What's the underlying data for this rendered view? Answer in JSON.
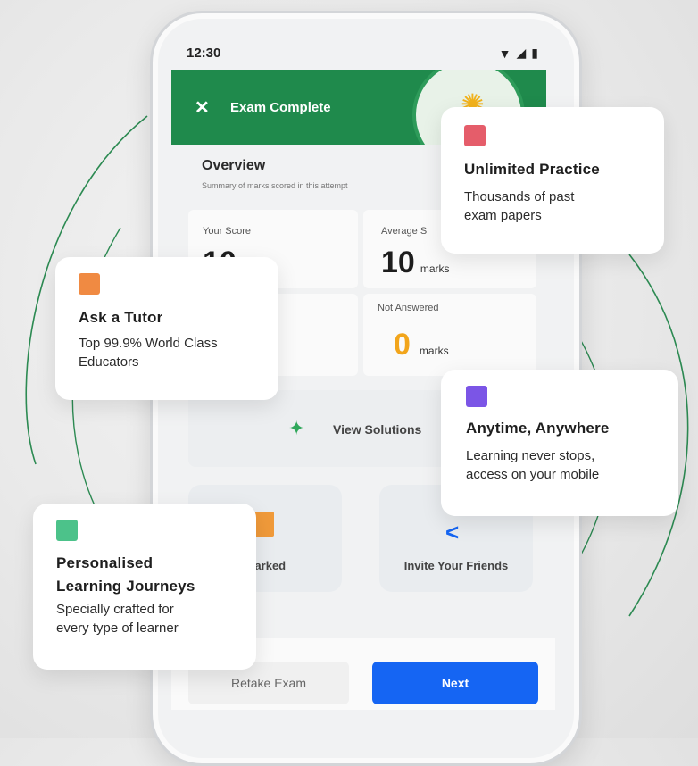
{
  "status_bar": {
    "time": "12:30",
    "signal_icon": "wifi-icon",
    "cell_icon": "cell-signal-icon",
    "battery_icon": "battery-icon"
  },
  "appbar": {
    "title": "Exam Complete",
    "close_icon": "close-icon",
    "badge_icon": "sun-icon",
    "color": "#1f8a4c"
  },
  "overview": {
    "title": "Overview",
    "subtitle": "Summary of marks scored in this attempt",
    "your_score": {
      "label": "Your Score",
      "value": "10",
      "unit": "marks"
    },
    "average_score": {
      "label": "Average S",
      "value": "10",
      "unit": "marks"
    },
    "not_answered": {
      "label": "Not Answered",
      "value": "0",
      "unit": "marks"
    }
  },
  "actions": {
    "view_solutions": "View Solutions",
    "bookmarked": "marked",
    "invite_friends": "Invite Your Friends",
    "retake": "Retake Exam",
    "next": "Next",
    "next_color": "#1565f3"
  },
  "features": [
    {
      "title": "Unlimited Practice",
      "desc1": "Thousands of past",
      "desc2": "exam papers",
      "color": "#e55d6a"
    },
    {
      "title": "Ask a Tutor",
      "desc1": "Top 99.9% World Class",
      "desc2": "Educators",
      "color": "#f08a42"
    },
    {
      "title": "Anytime, Anywhere",
      "desc1": "Learning never stops,",
      "desc2": "access on your mobile",
      "color": "#7b55e6"
    },
    {
      "title1": "Personalised",
      "title2": "Learning Journeys",
      "desc1": "Specially crafted for",
      "desc2": "every type of learner",
      "color": "#4cc28a"
    }
  ]
}
